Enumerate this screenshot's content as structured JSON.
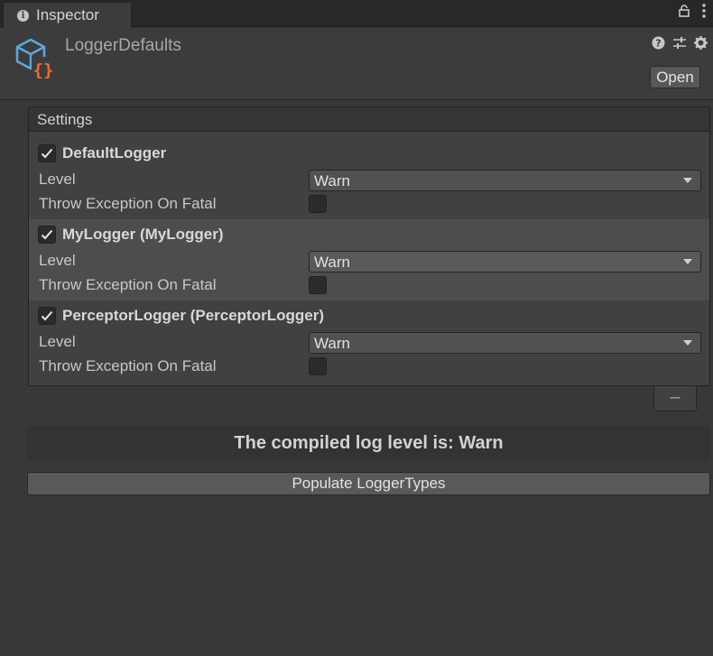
{
  "tab": {
    "label": "Inspector"
  },
  "header": {
    "title": "LoggerDefaults",
    "open_label": "Open"
  },
  "settings": {
    "title": "Settings",
    "loggers": [
      {
        "name": "DefaultLogger",
        "enabled": true,
        "level_label": "Level",
        "level": "Warn",
        "fatal_label": "Throw Exception On Fatal",
        "throw_on_fatal": false
      },
      {
        "name": "MyLogger (MyLogger)",
        "enabled": true,
        "level_label": "Level",
        "level": "Warn",
        "fatal_label": "Throw Exception On Fatal",
        "throw_on_fatal": false
      },
      {
        "name": "PerceptorLogger (PerceptorLogger)",
        "enabled": true,
        "level_label": "Level",
        "level": "Warn",
        "fatal_label": "Throw Exception On Fatal",
        "throw_on_fatal": false
      }
    ],
    "remove_label": "–"
  },
  "info": {
    "text": "The compiled log level is: Warn"
  },
  "populate": {
    "label": "Populate LoggerTypes"
  },
  "colors": {
    "background": "#383838",
    "icon_blue": "#5aa8e0",
    "icon_orange": "#f06a2c"
  },
  "icons": {
    "tab": "info-icon",
    "lock": "lock-icon",
    "menu": "kebab-menu-icon",
    "help": "help-icon",
    "presets": "sliders-icon",
    "settings": "gear-icon"
  }
}
